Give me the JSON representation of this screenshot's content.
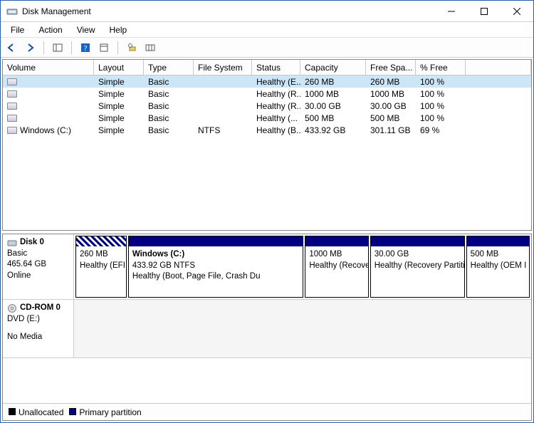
{
  "window": {
    "title": "Disk Management"
  },
  "menu": [
    "File",
    "Action",
    "View",
    "Help"
  ],
  "toolbar_icons": [
    "back",
    "forward",
    "panes",
    "help",
    "properties",
    "refresh",
    "columns"
  ],
  "columns": [
    "Volume",
    "Layout",
    "Type",
    "File System",
    "Status",
    "Capacity",
    "Free Spa...",
    "% Free"
  ],
  "volumes": [
    {
      "name": "",
      "layout": "Simple",
      "type": "Basic",
      "fs": "",
      "status": "Healthy (E...",
      "capacity": "260 MB",
      "free": "260 MB",
      "pct": "100 %",
      "selected": true
    },
    {
      "name": "",
      "layout": "Simple",
      "type": "Basic",
      "fs": "",
      "status": "Healthy (R...",
      "capacity": "1000 MB",
      "free": "1000 MB",
      "pct": "100 %",
      "selected": false
    },
    {
      "name": "",
      "layout": "Simple",
      "type": "Basic",
      "fs": "",
      "status": "Healthy (R...",
      "capacity": "30.00 GB",
      "free": "30.00 GB",
      "pct": "100 %",
      "selected": false
    },
    {
      "name": "",
      "layout": "Simple",
      "type": "Basic",
      "fs": "",
      "status": "Healthy (...",
      "capacity": "500 MB",
      "free": "500 MB",
      "pct": "100 %",
      "selected": false
    },
    {
      "name": "Windows (C:)",
      "layout": "Simple",
      "type": "Basic",
      "fs": "NTFS",
      "status": "Healthy (B...",
      "capacity": "433.92 GB",
      "free": "301.11 GB",
      "pct": "69 %",
      "selected": false
    }
  ],
  "disks": [
    {
      "label_name": "Disk 0",
      "label_type": "Basic",
      "label_size": "465.64 GB",
      "label_state": "Online",
      "height": 92,
      "partitions": [
        {
          "flex": 8,
          "efi": true,
          "name": "",
          "line2": "260 MB",
          "line3": "Healthy (EFI"
        },
        {
          "flex": 28,
          "efi": false,
          "name": "Windows  (C:)",
          "line2": "433.92 GB NTFS",
          "line3": "Healthy (Boot, Page File, Crash Du"
        },
        {
          "flex": 10,
          "efi": false,
          "name": "",
          "line2": "1000 MB",
          "line3": "Healthy (Recove"
        },
        {
          "flex": 15,
          "efi": false,
          "name": "",
          "line2": "30.00 GB",
          "line3": "Healthy (Recovery Partitio"
        },
        {
          "flex": 10,
          "efi": false,
          "name": "",
          "line2": "500 MB",
          "line3": "Healthy (OEM I"
        }
      ]
    },
    {
      "label_name": "CD-ROM 0",
      "label_type": "DVD (E:)",
      "label_size": "",
      "label_state": "No Media",
      "height": 82,
      "cdrom": true
    }
  ],
  "legend": {
    "unallocated": "Unallocated",
    "primary": "Primary partition"
  }
}
